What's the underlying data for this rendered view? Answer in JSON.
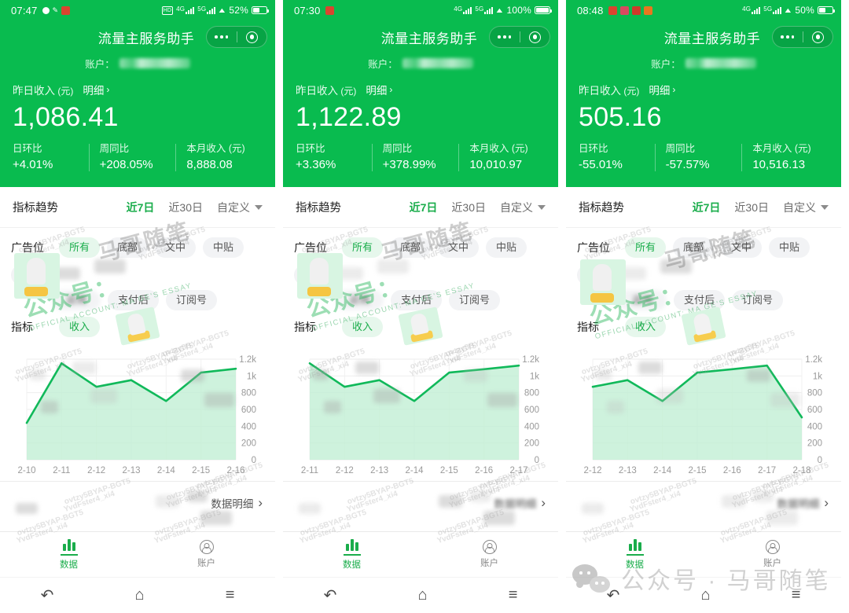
{
  "app": {
    "nav_title": "流量主服务助手",
    "account_label": "账户："
  },
  "panels": [
    {
      "status": {
        "time": "07:47",
        "battery": "52%",
        "net1": "4G",
        "net2": "5G",
        "hd": "HD"
      },
      "income": {
        "label": "昨日收入",
        "unit": "(元)",
        "detail": "明细",
        "value": "1,086.41"
      },
      "stats": [
        {
          "label": "日环比",
          "value": "+4.01%"
        },
        {
          "label": "周同比",
          "value": "+208.05%"
        },
        {
          "label": "本月收入 (元)",
          "value": "8,888.08"
        }
      ],
      "trend": {
        "title": "指标趋势",
        "tabs": [
          "近7日",
          "近30日",
          "自定义"
        ],
        "active": "近7日"
      },
      "filters": {
        "slot_label": "广告位",
        "slots_row1": [
          "所有",
          "底部",
          "文中",
          "中贴",
          "后贴"
        ],
        "slots_row2": [
          "返佣",
          "支付后",
          "订阅号"
        ],
        "active_slot": "所有",
        "metric_label": "指标",
        "metrics": [
          "收入"
        ],
        "active_metric": "收入"
      },
      "detail_link": "数据明细",
      "tabbar": [
        {
          "label": "数据",
          "active": true
        },
        {
          "label": "账户",
          "active": false
        }
      ]
    },
    {
      "status": {
        "time": "07:30",
        "battery": "100%",
        "net1": "4G",
        "net2": "5G",
        "hd": ""
      },
      "income": {
        "label": "昨日收入",
        "unit": "(元)",
        "detail": "明细",
        "value": "1,122.89"
      },
      "stats": [
        {
          "label": "日环比",
          "value": "+3.36%"
        },
        {
          "label": "周同比",
          "value": "+378.99%"
        },
        {
          "label": "本月收入 (元)",
          "value": "10,010.97"
        }
      ],
      "trend": {
        "title": "指标趋势",
        "tabs": [
          "近7日",
          "近30日",
          "自定义"
        ],
        "active": "近7日"
      },
      "filters": {
        "slot_label": "广告位",
        "slots_row1": [
          "所有",
          "底部",
          "文中",
          "中贴",
          "后贴"
        ],
        "slots_row2": [
          "返佣",
          "支付后",
          "订阅号"
        ],
        "active_slot": "所有",
        "metric_label": "指标",
        "metrics": [
          "收入"
        ],
        "active_metric": "收入"
      },
      "detail_link": "数据明细",
      "tabbar": [
        {
          "label": "数据",
          "active": true
        },
        {
          "label": "账户",
          "active": false
        }
      ]
    },
    {
      "status": {
        "time": "08:48",
        "battery": "50%",
        "net1": "4G",
        "net2": "5G",
        "hd": ""
      },
      "income": {
        "label": "昨日收入",
        "unit": "(元)",
        "detail": "明细",
        "value": "505.16"
      },
      "stats": [
        {
          "label": "日环比",
          "value": "-55.01%"
        },
        {
          "label": "周同比",
          "value": "-57.57%"
        },
        {
          "label": "本月收入 (元)",
          "value": "10,516.13"
        }
      ],
      "trend": {
        "title": "指标趋势",
        "tabs": [
          "近7日",
          "近30日",
          "自定义"
        ],
        "active": "近7日"
      },
      "filters": {
        "slot_label": "广告位",
        "slots_row1": [
          "所有",
          "底部",
          "文中",
          "中贴",
          "后贴"
        ],
        "slots_row2": [
          "返佣",
          "支付后",
          "订阅号"
        ],
        "active_slot": "所有",
        "metric_label": "指标",
        "metrics": [
          "收入"
        ],
        "active_metric": "收入"
      },
      "detail_link": "数据明细",
      "tabbar": [
        {
          "label": "数据",
          "active": true
        },
        {
          "label": "账户",
          "active": false
        }
      ]
    }
  ],
  "chart_data": [
    {
      "type": "area",
      "title": "指标趋势 近7日 收入",
      "categories": [
        "2-10",
        "2-11",
        "2-12",
        "2-13",
        "2-14",
        "2-15",
        "2-16"
      ],
      "values": [
        440,
        1150,
        870,
        950,
        700,
        1040,
        1086
      ],
      "ylim": [
        0,
        1200
      ],
      "yticks": [
        0,
        200,
        400,
        600,
        800,
        1000,
        1200
      ],
      "yticklabels": [
        "0",
        "200",
        "400",
        "600",
        "800",
        "1k",
        "1.2k"
      ],
      "xlabel": "",
      "ylabel": "",
      "grid": true,
      "line_color": "#10b95a",
      "fill_color": "#bdeed1"
    },
    {
      "type": "area",
      "title": "指标趋势 近7日 收入",
      "categories": [
        "2-11",
        "2-12",
        "2-13",
        "2-14",
        "2-15",
        "2-16",
        "2-17"
      ],
      "values": [
        1150,
        870,
        950,
        700,
        1040,
        1080,
        1123
      ],
      "ylim": [
        0,
        1200
      ],
      "yticks": [
        0,
        200,
        400,
        600,
        800,
        1000,
        1200
      ],
      "yticklabels": [
        "0",
        "200",
        "400",
        "600",
        "800",
        "1k",
        "1.2k"
      ],
      "xlabel": "",
      "ylabel": "",
      "grid": true,
      "line_color": "#10b95a",
      "fill_color": "#bdeed1"
    },
    {
      "type": "area",
      "title": "指标趋势 近7日 收入",
      "categories": [
        "2-12",
        "2-13",
        "2-14",
        "2-15",
        "2-16",
        "2-17",
        "2-18"
      ],
      "values": [
        870,
        950,
        700,
        1040,
        1080,
        1123,
        505
      ],
      "ylim": [
        0,
        1200
      ],
      "yticks": [
        0,
        200,
        400,
        600,
        800,
        1000,
        1200
      ],
      "yticklabels": [
        "0",
        "200",
        "400",
        "600",
        "800",
        "1k",
        "1.2k"
      ],
      "xlabel": "",
      "ylabel": "",
      "grid": true,
      "line_color": "#10b95a",
      "fill_color": "#bdeed1"
    }
  ],
  "watermark": {
    "brand": "公众号：",
    "brand_name": "马哥随笔",
    "sub": "OFFICIAL ACCOUNT: MA GE'S ESSAY",
    "tile1": "ovtzy5BYAP-BGT5",
    "tile2": "YvdFster4_xi4",
    "wechat_overlay": "公众号 · 马哥随笔"
  },
  "navkeys": {
    "back": "back-key",
    "home": "home-key",
    "menu": "menu-key"
  },
  "colors": {
    "brand_green": "#09bb4f",
    "accent_green": "#1aad4b",
    "line_green": "#10b95a",
    "fill_green": "#bdeed1",
    "chip_bg": "#f2f3f5",
    "chip_on_bg": "#e6f7ec"
  }
}
